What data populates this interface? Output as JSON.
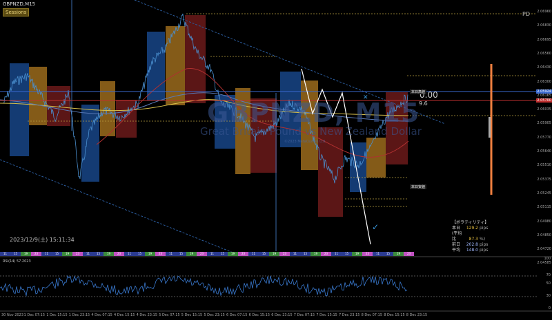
{
  "chart": {
    "symbol": "GBPNZD,M15",
    "sessions_label": "Sessions",
    "period_label": "PD",
    "watermark_symbol": "GBPNZD, M15",
    "watermark_name": "Great Britain Pound vs New Zealand Dollar",
    "watermark_url": "©2023 MetaQuotes Ltd.",
    "datetime": "2023/12/9(土) 15:11:34",
    "big_number": "0.00",
    "small_number": "9.6",
    "today_high_label": "本日高値",
    "today_low_label": "本日安値",
    "colors": {
      "up": "#4a90d0",
      "down": "#d05050",
      "session_blue": "#1b4f9a",
      "session_orange": "#b07a20",
      "session_red": "#7a1e1e",
      "ma_yellow": "#d8c04a"
    }
  },
  "price_scale": [
    "2.06960",
    "2.06830",
    "2.06695",
    "2.06560",
    "2.06430",
    "2.06300",
    "2.06165",
    "2.06035",
    "2.05905",
    "2.05770",
    "2.05640",
    "2.05510",
    "2.05375",
    "2.05245",
    "2.05115",
    "2.04980",
    "2.04850",
    "2.04720",
    "2.04585"
  ],
  "price_tags": {
    "current": "2.05924",
    "bid": "2.05700"
  },
  "volatility": {
    "title": "【ボラティリティ】",
    "rows": [
      {
        "label": "本日",
        "value": "129.2",
        "unit": "pips",
        "color": "#e8c040"
      },
      {
        "label": "(平均比",
        "value": "87.3",
        "unit": "%)",
        "color": "#e8c040"
      },
      {
        "label": "前日",
        "value": "202.8",
        "unit": "pips",
        "color": "#a0b8ff"
      },
      {
        "label": "平均",
        "value": "148.0",
        "unit": "pips",
        "color": "#a0b8ff"
      }
    ]
  },
  "session_strip": [
    "11",
    "15",
    "19",
    "23",
    "11",
    "15",
    "19",
    "23",
    "11",
    "15",
    "19",
    "23",
    "11",
    "15",
    "19",
    "23",
    "11",
    "15",
    "19",
    "23",
    "11",
    "15",
    "19",
    "23",
    "11",
    "15",
    "19",
    "23",
    "11",
    "15",
    "19",
    "23",
    "11",
    "15",
    "19",
    "23",
    "11",
    "15",
    "19",
    "23"
  ],
  "rsi": {
    "label": "RSI(14) 57.2023",
    "scale": [
      "100",
      "70",
      "50",
      "30",
      "0"
    ]
  },
  "time_axis": [
    "30 Nov 2023",
    "1 Dec 07:15",
    "1 Dec 15:15",
    "1 Dec 23:15",
    "4 Dec 07:15",
    "4 Dec 15:15",
    "4 Dec 23:15",
    "5 Dec 07:15",
    "5 Dec 15:15",
    "5 Dec 23:15",
    "6 Dec 07:15",
    "6 Dec 15:15",
    "6 Dec 23:15",
    "7 Dec 07:15",
    "7 Dec 15:15",
    "7 Dec 23:15",
    "8 Dec 07:15",
    "8 Dec 15:15",
    "8 Dec 23:15"
  ]
}
